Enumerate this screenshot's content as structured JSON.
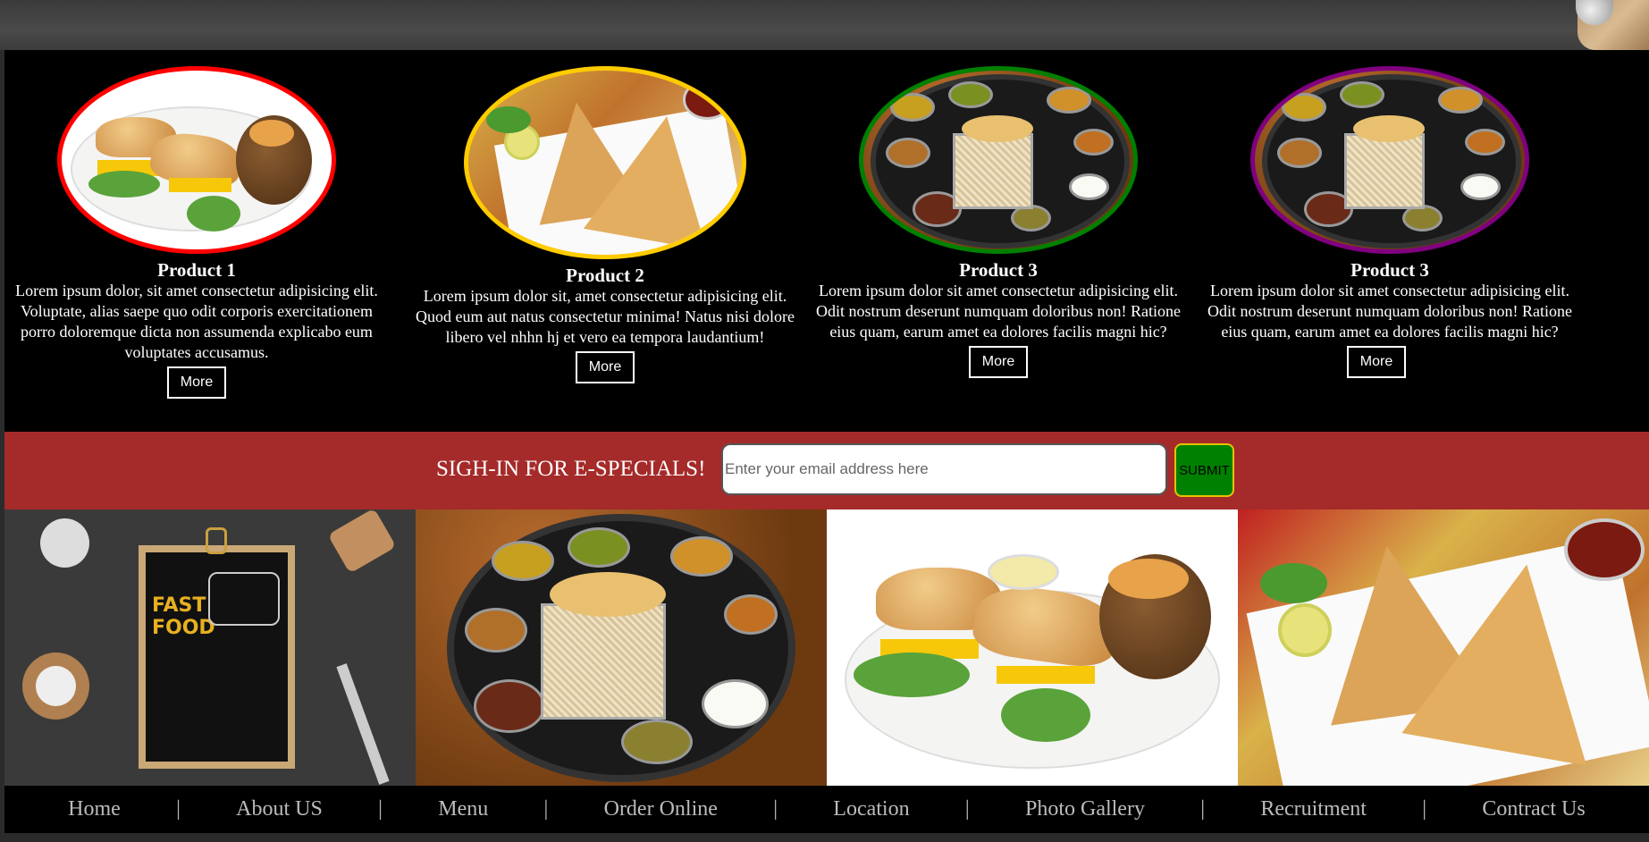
{
  "products": [
    {
      "title": "Product 1",
      "description": "Lorem ipsum dolor, sit amet consectetur adipisicing elit. Voluptate, alias saepe quo odit corporis exercitationem porro doloremque dicta non assumenda explicabo eum voluptates accusamus.",
      "button": "More",
      "border_color": "#ff0000",
      "image": "burger-plate-image"
    },
    {
      "title": "Product 2",
      "description": "Lorem ipsum dolor sit, amet consectetur adipisicing elit. Quod eum aut natus consectetur minima! Natus nisi dolore libero vel nhhn hj et vero ea tempora laudantium!",
      "button": "More",
      "border_color": "#ffcc00",
      "image": "samosa-plate-image"
    },
    {
      "title": "Product 3",
      "description": "Lorem ipsum dolor sit amet consectetur adipisicing elit. Odit nostrum deserunt numquam doloribus non! Ratione eius quam, earum amet ea dolores facilis magni hic?",
      "button": "More",
      "border_color": "#008000",
      "image": "thali-plate-image"
    },
    {
      "title": "Product 3",
      "description": "Lorem ipsum dolor sit amet consectetur adipisicing elit. Odit nostrum deserunt numquam doloribus non! Ratione eius quam, earum amet ea dolores facilis magni hic?",
      "button": "More",
      "border_color": "#800080",
      "image": "thali-plate-image"
    }
  ],
  "signup": {
    "label": "SIGH-IN FOR E-SPECIALS!",
    "placeholder": "Enter your email address here",
    "submit": "SUBMIT"
  },
  "gallery": [
    "fast-food-menu-image",
    "thali-image",
    "burger-image",
    "samosa-image"
  ],
  "nav": [
    "Home",
    "About US",
    "Menu",
    "Order Online",
    "Location",
    "Photo Gallery",
    "Recruitment",
    "Contract Us"
  ],
  "colors": {
    "signup_bg": "#a52a2a",
    "submit_bg": "#008000",
    "page_bg": "#000000"
  }
}
